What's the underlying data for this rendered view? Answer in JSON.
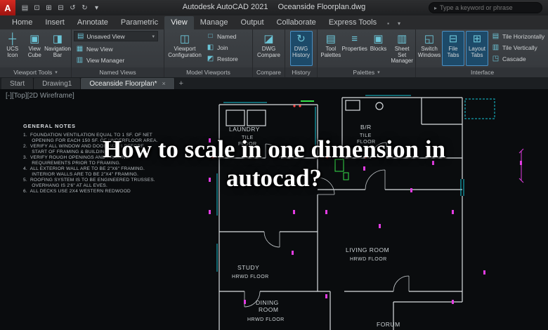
{
  "titlebar": {
    "logo": "A",
    "app_title": "Autodesk AutoCAD 2021",
    "doc_title": "Oceanside Floorplan.dwg",
    "search_placeholder": "Type a keyword or phrase"
  },
  "icons": {
    "qat": [
      "▤",
      "⊡",
      "⊞",
      "⊟",
      "↺",
      "↻"
    ],
    "dropdown": "▾",
    "search_caret": "▸",
    "ribbon_opt": "▪",
    "close": "×",
    "add": "+",
    "ucs": "┼",
    "view_cube": "▣",
    "nav_bar": "◨",
    "named_view_dd": "▤",
    "new_view": "▦",
    "view_manager": "▥",
    "viewport_config": "◫",
    "named": "□",
    "join": "◧",
    "restore": "◩",
    "dwg_compare": "◪",
    "dwg_history": "↻",
    "tool_palettes": "▤",
    "properties": "≡",
    "blocks": "▣",
    "sheet_set": "▥",
    "switch_windows": "◱",
    "file_tabs": "⊟",
    "layout_tabs": "⊞",
    "tile_h": "▤",
    "tile_v": "▥",
    "cascade": "◳"
  },
  "ribbon": {
    "tabs": [
      "Home",
      "Insert",
      "Annotate",
      "Parametric",
      "View",
      "Manage",
      "Output",
      "Collaborate",
      "Express Tools"
    ],
    "panels": {
      "viewport_tools": {
        "label": "Viewport Tools",
        "buttons": [
          [
            "UCS",
            "Icon"
          ],
          [
            "View",
            "Cube"
          ],
          [
            "Navigation",
            "Bar"
          ]
        ]
      },
      "named_views": {
        "label": "Named Views",
        "current": "Unsaved View",
        "new_view": "New View",
        "view_manager": "View Manager"
      },
      "model_viewports": {
        "label": "Model Viewports",
        "config": [
          "Viewport",
          "Configuration"
        ],
        "named": "Named",
        "join": "Join",
        "restore": "Restore"
      },
      "compare": {
        "label": "Compare",
        "button": [
          "DWG",
          "Compare"
        ]
      },
      "history": {
        "label": "History",
        "button": [
          "DWG",
          "History"
        ]
      },
      "palettes": {
        "label": "Palettes",
        "tool_palettes": [
          "Tool",
          "Palettes"
        ],
        "properties": "Properties",
        "blocks": "Blocks",
        "sheet_set": [
          "Sheet Set",
          "Manager"
        ]
      },
      "interface": {
        "label": "Interface",
        "switch_windows": [
          "Switch",
          "Windows"
        ],
        "file_tabs": [
          "File",
          "Tabs"
        ],
        "layout_tabs": [
          "Layout",
          "Tabs"
        ],
        "tile_h": "Tile Horizontally",
        "tile_v": "Tile Vertically",
        "cascade": "Cascade"
      }
    }
  },
  "file_tabs": {
    "items": [
      "Start",
      "Drawing1",
      "Oceanside Floorplan*"
    ]
  },
  "canvas": {
    "viewport_controls": "[-][Top][2D Wireframe]",
    "notes_title": "GENERAL NOTES",
    "notes": [
      "1.  FOUNDATION VENTILATION EQUAL TO 1 SF. OF NET",
      "      OPENING FOR EACH 150 SF. OF UNDERFLOOR AREA.",
      "2.  VERIFY ALL WINDOW AND DOOR SIZES BEFORE",
      "      START OF FRAMING & BUILDING.",
      "3.  VERIFY ROUGH OPENINGS AND FRAMING",
      "      REQUIREMENTS PRIOR TO FRAMING.",
      "4.  ALL EXTERIOR WALL ARE TO BE 2\"X6\" FRAMING.",
      "      INTERIOR WALLS ARE TO BE 2\"X4\" FRAMING.",
      "5.  ROOFING SYSTEM IS TO BE ENGINEERED TRUSSES.",
      "      OVERHANG IS 2'6\" AT ALL EVES.",
      "6.  ALL DECKS USE 2X4 WESTERN REDWOOD"
    ],
    "rooms": {
      "laundry": {
        "name": "LAUNDRY",
        "sub1": "TILE",
        "sub2": "FLOOR"
      },
      "br": {
        "name": "B/R",
        "sub1": "TILE",
        "sub2": "FLOOR"
      },
      "living": {
        "name": "LIVING ROOM",
        "sub1": "HRWD FLOOR"
      },
      "study": {
        "name": "STUDY",
        "sub1": "HRWD FLOOR"
      },
      "dining": {
        "name": "DINING",
        "sub1": "ROOM",
        "sub2": "HRWD FLOOR"
      },
      "forum": {
        "name": "FORUM"
      }
    },
    "headline": {
      "line1": "How to scale in one dimension in",
      "line2": "autocad?"
    }
  }
}
